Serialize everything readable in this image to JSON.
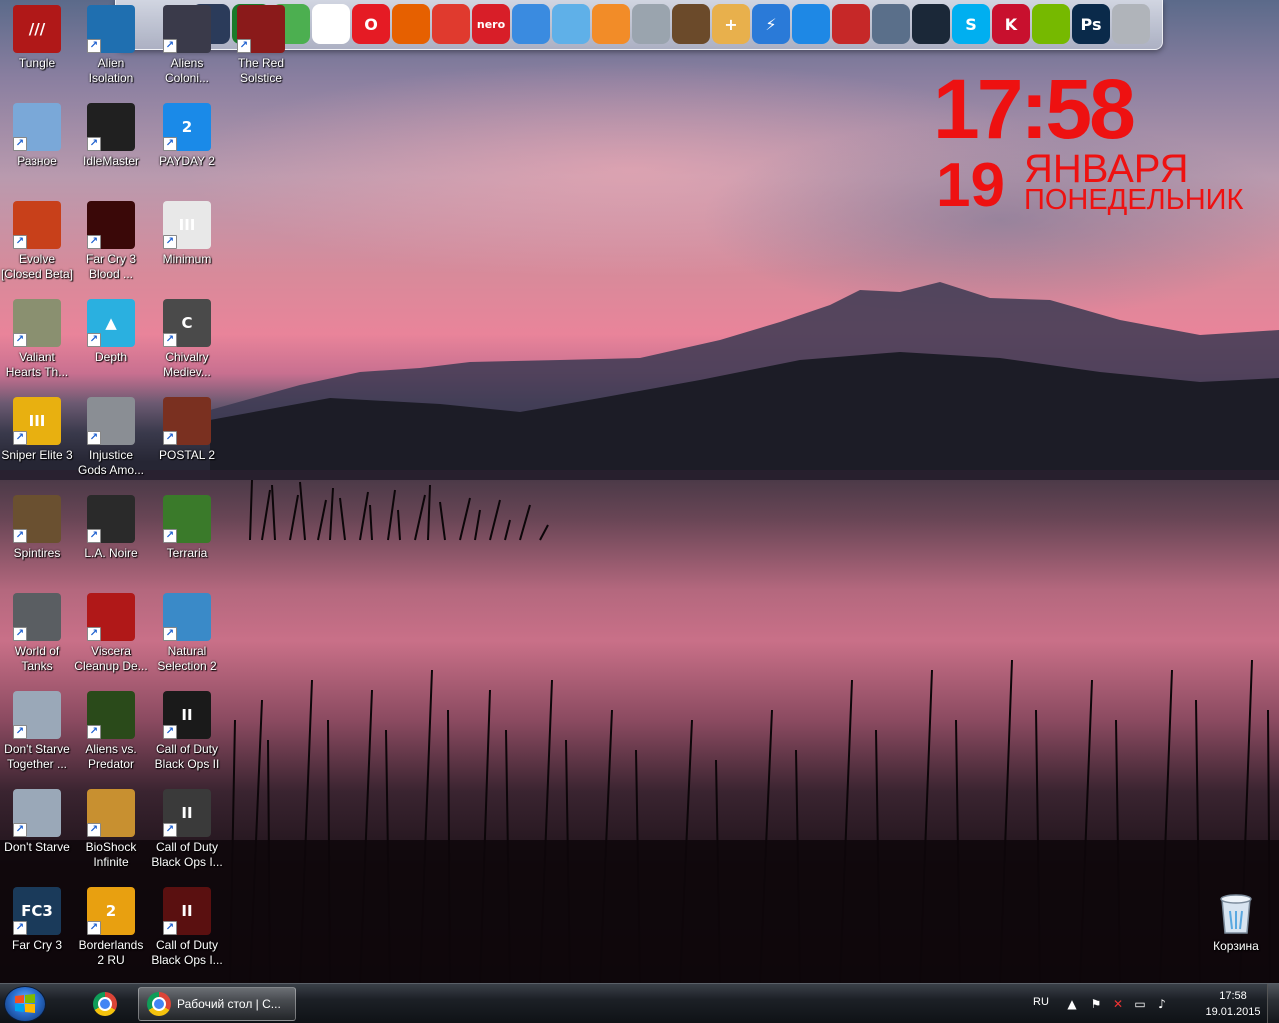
{
  "dock": {
    "icons": [
      {
        "name": "steam-overlay-icon",
        "glyph": "",
        "bg": "#2b3b5a"
      },
      {
        "name": "ccleaner-icon",
        "glyph": "",
        "bg": "#1a7a2a"
      },
      {
        "name": "tracker-icon",
        "glyph": "",
        "bg": "#4caf50"
      },
      {
        "name": "chrome-icon",
        "glyph": "",
        "bg": "#ffffff"
      },
      {
        "name": "opera-icon",
        "glyph": "O",
        "bg": "#e51b24"
      },
      {
        "name": "firefox-icon",
        "glyph": "",
        "bg": "#e66000"
      },
      {
        "name": "ccleaner-brush-icon",
        "glyph": "",
        "bg": "#e03a2e"
      },
      {
        "name": "nero-icon",
        "glyph": "nero",
        "bg": "#d81e28"
      },
      {
        "name": "crescent-icon",
        "glyph": "",
        "bg": "#3a8be0"
      },
      {
        "name": "photo-icon",
        "glyph": "",
        "bg": "#5fb0e8"
      },
      {
        "name": "eye-icon",
        "glyph": "",
        "bg": "#f28c28"
      },
      {
        "name": "disk-stack-icon",
        "glyph": "",
        "bg": "#9aa4ae"
      },
      {
        "name": "archive-icon",
        "glyph": "",
        "bg": "#6b4a2a"
      },
      {
        "name": "first-aid-icon",
        "glyph": "+",
        "bg": "#e8b04c"
      },
      {
        "name": "lightning-icon",
        "glyph": "⚡",
        "bg": "#2a7ad8"
      },
      {
        "name": "color-ball-icon",
        "glyph": "",
        "bg": "#1e88e5"
      },
      {
        "name": "maple-leaf-icon",
        "glyph": "",
        "bg": "#c62828"
      },
      {
        "name": "teamspeak-icon",
        "glyph": "",
        "bg": "#5a6f8a"
      },
      {
        "name": "steam-icon",
        "glyph": "",
        "bg": "#1b2838"
      },
      {
        "name": "skype-icon",
        "glyph": "S",
        "bg": "#00aff0"
      },
      {
        "name": "kaspersky-icon",
        "glyph": "K",
        "bg": "#c8102e"
      },
      {
        "name": "nvidia-icon",
        "glyph": "",
        "bg": "#76b900"
      },
      {
        "name": "photoshop-icon",
        "glyph": "Ps",
        "bg": "#0a2a4a"
      },
      {
        "name": "gamepad-icon",
        "glyph": "",
        "bg": "#b0b4ba"
      }
    ]
  },
  "desktop": {
    "icons": [
      {
        "label": "Tungle",
        "name": "desktop-icon-tungle",
        "col": 0,
        "row": 0,
        "bg": "#b01818",
        "glyph": "///"
      },
      {
        "label": "Alien\nIsolation",
        "name": "desktop-icon-alien-isolation",
        "col": 1,
        "row": 0,
        "bg": "#1f6fb0",
        "glyph": ""
      },
      {
        "label": "Aliens\nColoni...",
        "name": "desktop-icon-aliens-colonial",
        "col": 2,
        "row": 0,
        "bg": "#3a3a4a",
        "glyph": ""
      },
      {
        "label": "The Red\nSolstice",
        "name": "desktop-icon-the-red-solstice",
        "col": 3,
        "row": 0,
        "bg": "#8a1a1a",
        "glyph": ""
      },
      {
        "label": "Разное",
        "name": "desktop-icon-raznoe",
        "col": 0,
        "row": 1,
        "bg": "#7aa8d8",
        "glyph": ""
      },
      {
        "label": "IdleMaster",
        "name": "desktop-icon-idlemaster",
        "col": 1,
        "row": 1,
        "bg": "#202020",
        "glyph": ""
      },
      {
        "label": "PAYDAY 2",
        "name": "desktop-icon-payday-2",
        "col": 2,
        "row": 1,
        "bg": "#1a8ae8",
        "glyph": "2"
      },
      {
        "label": "Evolve\n[Closed Beta]",
        "name": "desktop-icon-evolve",
        "col": 0,
        "row": 2,
        "bg": "#c8401a",
        "glyph": ""
      },
      {
        "label": "Far Cry 3\nBlood ...",
        "name": "desktop-icon-far-cry-3-blood-dragon",
        "col": 1,
        "row": 2,
        "bg": "#3a0808",
        "glyph": ""
      },
      {
        "label": "Minimum",
        "name": "desktop-icon-minimum",
        "col": 2,
        "row": 2,
        "bg": "#e8e8e8",
        "glyph": "III"
      },
      {
        "label": "Valiant\nHearts Th...",
        "name": "desktop-icon-valiant-hearts",
        "col": 0,
        "row": 3,
        "bg": "#8a9070",
        "glyph": ""
      },
      {
        "label": "Depth",
        "name": "desktop-icon-depth",
        "col": 1,
        "row": 3,
        "bg": "#2ab0e0",
        "glyph": "▲"
      },
      {
        "label": "Chivalry\nMediev...",
        "name": "desktop-icon-chivalry",
        "col": 2,
        "row": 3,
        "bg": "#4a4a4a",
        "glyph": "C"
      },
      {
        "label": "Sniper Elite 3",
        "name": "desktop-icon-sniper-elite-3",
        "col": 0,
        "row": 4,
        "bg": "#e8b010",
        "glyph": "III"
      },
      {
        "label": "Injustice\nGods Amo...",
        "name": "desktop-icon-injustice",
        "col": 1,
        "row": 4,
        "bg": "#8a8e94",
        "glyph": ""
      },
      {
        "label": "POSTAL 2",
        "name": "desktop-icon-postal-2",
        "col": 2,
        "row": 4,
        "bg": "#7a3020",
        "glyph": ""
      },
      {
        "label": "Spintires",
        "name": "desktop-icon-spintires",
        "col": 0,
        "row": 5,
        "bg": "#6a5030",
        "glyph": ""
      },
      {
        "label": "L.A. Noire",
        "name": "desktop-icon-la-noire",
        "col": 1,
        "row": 5,
        "bg": "#2a2a2a",
        "glyph": ""
      },
      {
        "label": "Terraria",
        "name": "desktop-icon-terraria",
        "col": 2,
        "row": 5,
        "bg": "#3a7a2a",
        "glyph": ""
      },
      {
        "label": "World of\nTanks",
        "name": "desktop-icon-world-of-tanks",
        "col": 0,
        "row": 6,
        "bg": "#5a5e62",
        "glyph": ""
      },
      {
        "label": "Viscera\nCleanup De...",
        "name": "desktop-icon-viscera-cleanup",
        "col": 1,
        "row": 6,
        "bg": "#b01818",
        "glyph": ""
      },
      {
        "label": "Natural\nSelection 2",
        "name": "desktop-icon-natural-selection-2",
        "col": 2,
        "row": 6,
        "bg": "#3a8ac8",
        "glyph": ""
      },
      {
        "label": "Don't Starve\nTogether ...",
        "name": "desktop-icon-dont-starve-together",
        "col": 0,
        "row": 7,
        "bg": "#9aa8b8",
        "glyph": ""
      },
      {
        "label": "Aliens vs.\nPredator",
        "name": "desktop-icon-aliens-vs-predator",
        "col": 1,
        "row": 7,
        "bg": "#2a4a1a",
        "glyph": ""
      },
      {
        "label": "Call of Duty\nBlack Ops II",
        "name": "desktop-icon-cod-black-ops-2",
        "col": 2,
        "row": 7,
        "bg": "#1a1a1a",
        "glyph": "II"
      },
      {
        "label": "Don't Starve",
        "name": "desktop-icon-dont-starve",
        "col": 0,
        "row": 8,
        "bg": "#9aa8b8",
        "glyph": ""
      },
      {
        "label": "BioShock\nInfinite",
        "name": "desktop-icon-bioshock-infinite",
        "col": 1,
        "row": 8,
        "bg": "#c89030",
        "glyph": ""
      },
      {
        "label": "Call of Duty\nBlack Ops I...",
        "name": "desktop-icon-cod-black-ops-a",
        "col": 2,
        "row": 8,
        "bg": "#3a3a3a",
        "glyph": "II"
      },
      {
        "label": "Far Cry 3",
        "name": "desktop-icon-far-cry-3",
        "col": 0,
        "row": 9,
        "bg": "#1a3a5a",
        "glyph": "FC3"
      },
      {
        "label": "Borderlands\n2 RU",
        "name": "desktop-icon-borderlands-2",
        "col": 1,
        "row": 9,
        "bg": "#e8a010",
        "glyph": "2"
      },
      {
        "label": "Call of Duty\nBlack Ops I...",
        "name": "desktop-icon-cod-black-ops-b",
        "col": 2,
        "row": 9,
        "bg": "#5a1010",
        "glyph": "II"
      }
    ],
    "recycle_bin": {
      "label": "Корзина"
    }
  },
  "clock_widget": {
    "time": "17:58",
    "day": "19",
    "month": "ЯНВАРЯ",
    "weekday": "ПОНЕДЕЛЬНИК",
    "color": "#ee1111"
  },
  "taskbar": {
    "window_label": "Рабочий стол | С...",
    "lang": "RU",
    "time": "17:58",
    "date": "19.01.2015"
  }
}
